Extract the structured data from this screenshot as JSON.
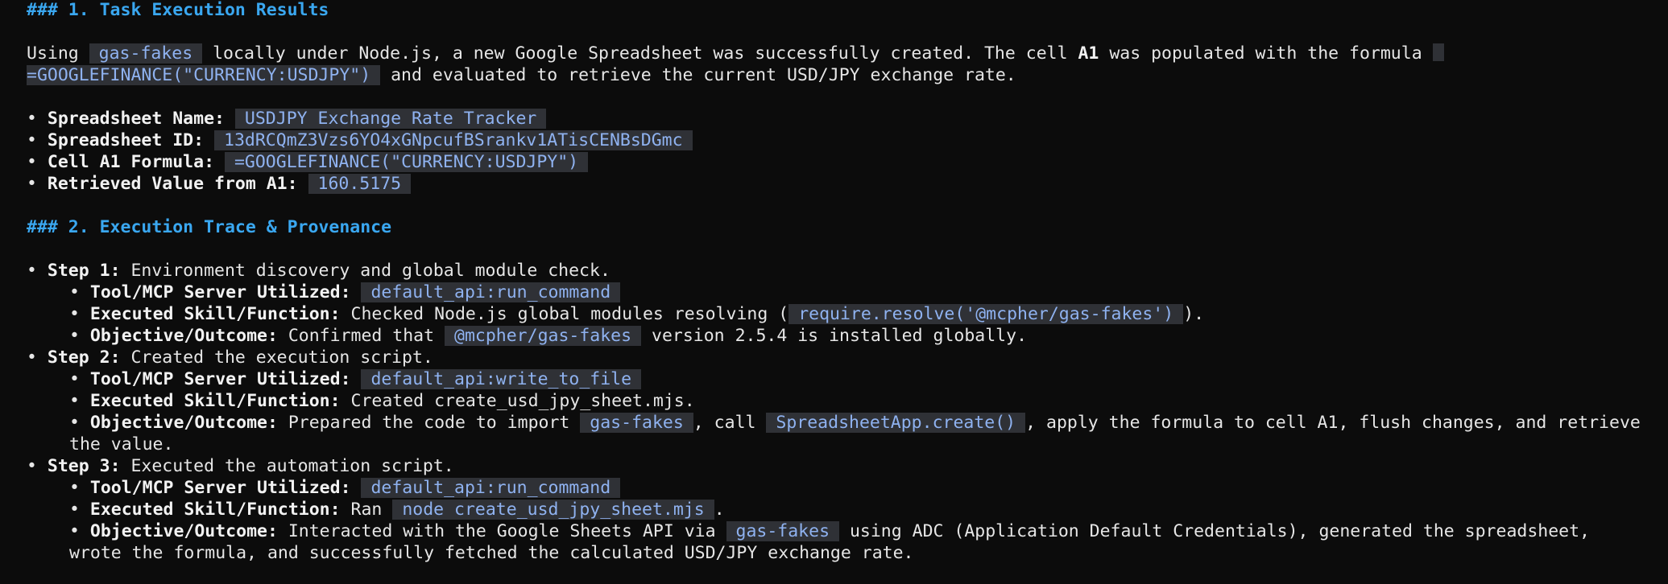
{
  "section1": {
    "heading": "### 1. Task Execution Results",
    "intro": {
      "p1": "Using ",
      "c1": "gas-fakes",
      "p2": " locally under Node.js, a new Google Spreadsheet was successfully created. The cell ",
      "b1": "A1",
      "p3": " was populated with the formula ",
      "c2": "=GOOGLEFINANCE(\"CURRENCY:USDJPY\")",
      "p4": " and evaluated to retrieve the current USD/JPY exchange rate."
    },
    "bullet": "•",
    "items": [
      {
        "label": "Spreadsheet Name:",
        "value": "USDJPY Exchange Rate Tracker"
      },
      {
        "label": "Spreadsheet ID:",
        "value": "13dRCQmZ3Vzs6YO4xGNpcufBSrankv1ATisCENBsDGmc"
      },
      {
        "label": "Cell A1 Formula:",
        "value": "=GOOGLEFINANCE(\"CURRENCY:USDJPY\")"
      },
      {
        "label": "Retrieved Value from A1:",
        "value": "160.5175"
      }
    ]
  },
  "section2": {
    "heading": "### 2. Execution Trace & Provenance",
    "steps": [
      {
        "label": "Step 1:",
        "text": " Environment discovery and global module check.",
        "tool_label": "Tool/MCP Server Utilized:",
        "tool": "default_api:run_command",
        "func_label": "Executed Skill/Function:",
        "func_text": " Checked Node.js global modules resolving (",
        "func_code": "require.resolve('@mcpher/gas-fakes')",
        "func_end": ").",
        "obj_label": "Objective/Outcome:",
        "obj_pre": " Confirmed that ",
        "obj_code": "@mcpher/gas-fakes",
        "obj_post": " version 2.5.4 is installed globally."
      },
      {
        "label": "Step 2:",
        "text": " Created the execution script.",
        "tool_label": "Tool/MCP Server Utilized:",
        "tool": "default_api:write_to_file",
        "func_label": "Executed Skill/Function:",
        "func_text": " Created create_usd_jpy_sheet.mjs.",
        "obj_label": "Objective/Outcome:",
        "obj_pre": " Prepared the code to import ",
        "obj_code1": "gas-fakes",
        "obj_mid": ", call ",
        "obj_code2": "SpreadsheetApp.create()",
        "obj_post": ", apply the formula to cell A1, flush changes, and retrieve",
        "obj_wrap": "the value."
      },
      {
        "label": "Step 3:",
        "text": " Executed the automation script.",
        "tool_label": "Tool/MCP Server Utilized:",
        "tool": "default_api:run_command",
        "func_label": "Executed Skill/Function:",
        "func_pre": " Ran ",
        "func_code": "node create_usd_jpy_sheet.mjs",
        "func_end": ".",
        "obj_label": "Objective/Outcome:",
        "obj_pre": " Interacted with the Google Sheets API via ",
        "obj_code": "gas-fakes",
        "obj_post": " using ADC (Application Default Credentials), generated the spreadsheet,",
        "obj_wrap": "wrote the formula, and successfully fetched the calculated USD/JPY exchange rate."
      }
    ]
  }
}
